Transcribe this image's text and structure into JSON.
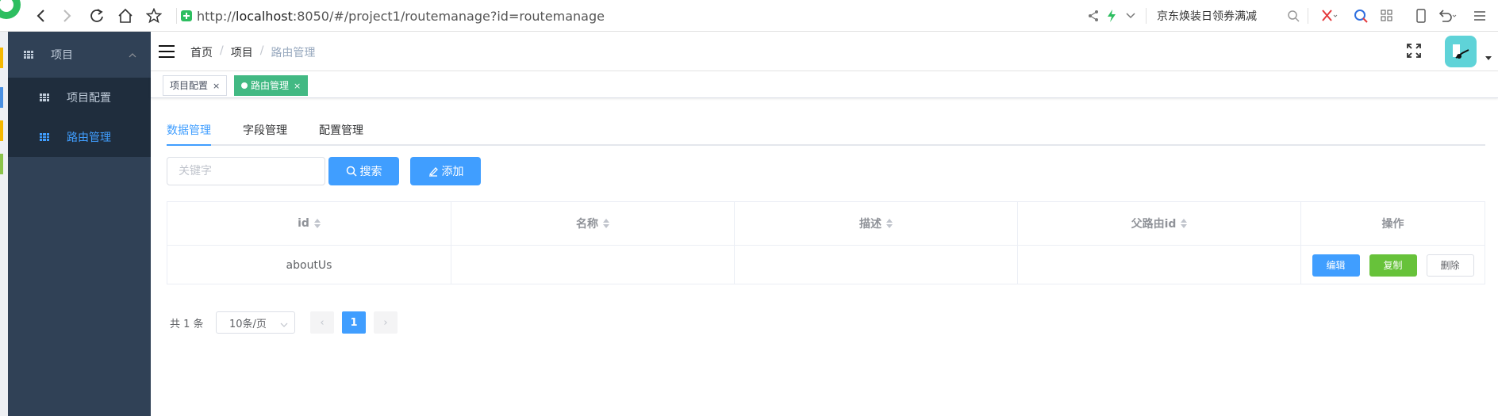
{
  "browser": {
    "url_prefix": "http://",
    "url_host": "localhost",
    "url_rest": ":8050/#/project1/routemanage?id=routemanage",
    "promo": "京东焕装日领券满减"
  },
  "sidebar": {
    "group_label": "项目",
    "items": [
      {
        "label": "项目配置",
        "active": false
      },
      {
        "label": "路由管理",
        "active": true
      }
    ]
  },
  "breadcrumb": {
    "items": [
      "首页",
      "项目",
      "路由管理"
    ],
    "separator": "/"
  },
  "tags_view": {
    "tags": [
      {
        "label": "项目配置",
        "active": false,
        "close": "×"
      },
      {
        "label": "路由管理",
        "active": true,
        "close": "×"
      }
    ]
  },
  "tabs": [
    {
      "label": "数据管理",
      "active": true
    },
    {
      "label": "字段管理",
      "active": false
    },
    {
      "label": "配置管理",
      "active": false
    }
  ],
  "toolbar": {
    "search_placeholder": "关键字",
    "search_value": "",
    "search_label": "搜索",
    "add_label": "添加"
  },
  "table": {
    "columns": [
      "id",
      "名称",
      "描述",
      "父路由id",
      "操作"
    ],
    "rows": [
      {
        "id": "aboutUs",
        "name": "",
        "desc": "",
        "parent_id": ""
      }
    ],
    "actions": {
      "edit": "编辑",
      "copy": "复制",
      "delete": "删除"
    }
  },
  "pagination": {
    "total_text": "共 1 条",
    "page_size": "10条/页",
    "current_page": "1",
    "prev": "‹",
    "next": "›"
  },
  "colors": {
    "primary": "#409eff",
    "success": "#67c23a",
    "tag_active": "#42b983",
    "sidebar_bg": "#304156",
    "submenu_bg": "#1f2d3d"
  }
}
